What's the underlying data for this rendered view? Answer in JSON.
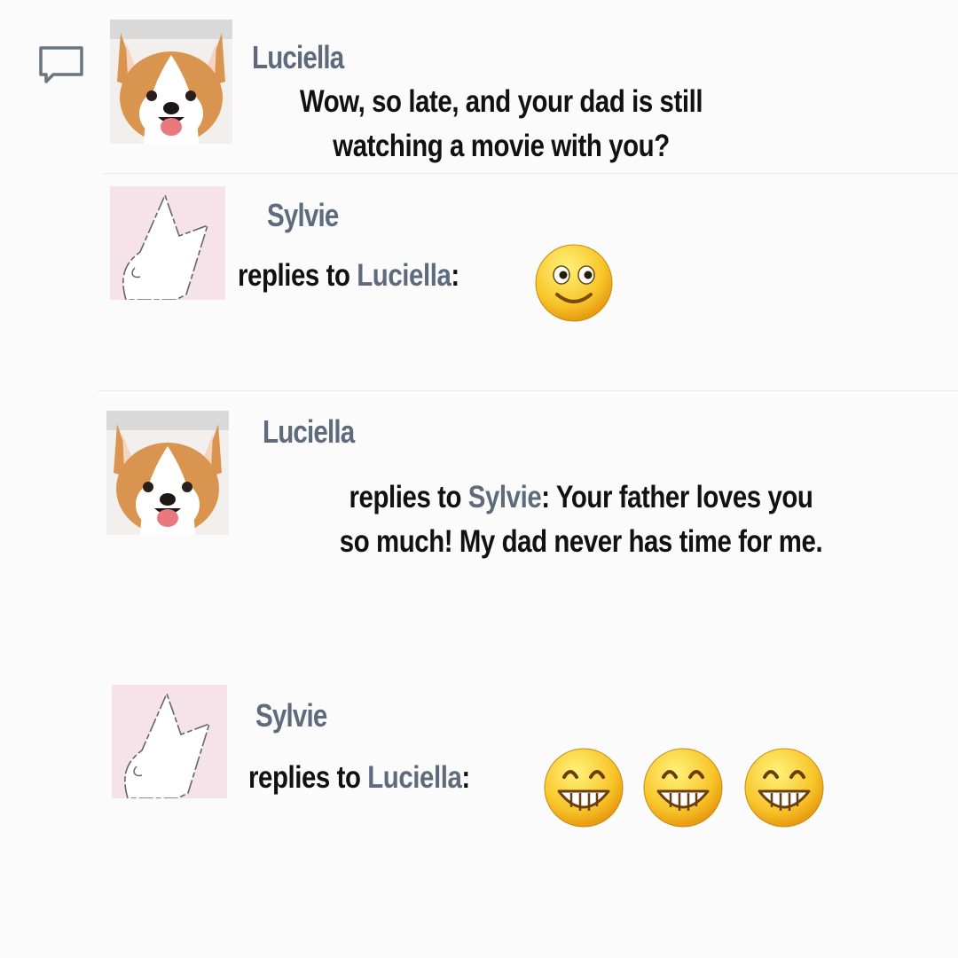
{
  "messages": [
    {
      "author": "Luciella",
      "avatar": "corgi-avatar",
      "text": "Wow, so late, and your dad is still",
      "text_line2": "watching a movie with you?"
    },
    {
      "author": "Sylvie",
      "avatar": "white-fox-avatar",
      "prefix": "replies to ",
      "reply_to": "Luciella",
      "suffix": ":",
      "emojis": [
        "smile-emoji"
      ]
    },
    {
      "author": "Luciella",
      "avatar": "corgi-avatar",
      "prefix": "replies to ",
      "reply_to": "Sylvie",
      "suffix": ": Your father loves you",
      "text_line2": "so much! My dad never has time for me."
    },
    {
      "author": "Sylvie",
      "avatar": "white-fox-avatar",
      "prefix": "replies to ",
      "reply_to": "Luciella",
      "suffix": ":",
      "emojis": [
        "grin-emoji",
        "grin-emoji",
        "grin-emoji"
      ]
    }
  ],
  "icons": {
    "comment": "comment-bubble-icon"
  },
  "colors": {
    "username": "#5f6b7c",
    "text": "#111111",
    "background": "#fbfbfc"
  }
}
